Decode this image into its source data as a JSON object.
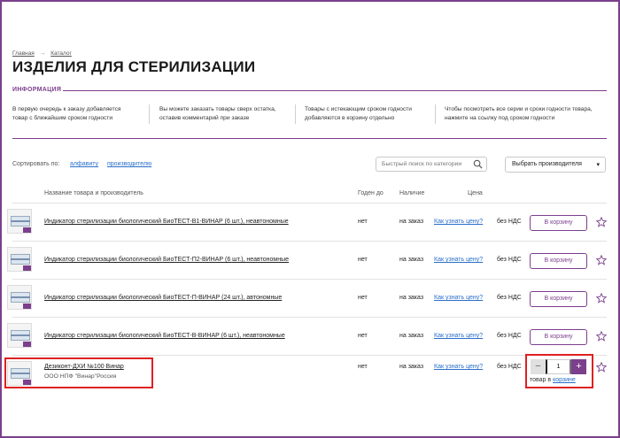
{
  "breadcrumb": {
    "home": "Главная",
    "separator": "→",
    "catalog": "Каталог"
  },
  "page_title": "ИЗДЕЛИЯ ДЛЯ СТЕРИЛИЗАЦИИ",
  "info": {
    "heading": "ИНФОРМАЦИЯ",
    "notes": [
      {
        "line1": "В первую очередь к заказу добавляется",
        "line2": "товар с ближайшим сроком годности"
      },
      {
        "line1": "Вы можете заказать товары сверх остатка,",
        "line2": "оставив комментарий при заказе"
      },
      {
        "line1": "Товары с истекающим сроком годности",
        "line2": "добавляются в корзину отдельно"
      },
      {
        "line1": "Чтобы посмотреть все серии и сроки годности товара,",
        "line2": "нажмите на ссылку под сроком годности"
      }
    ]
  },
  "sort": {
    "label": "Сортировать по:",
    "by_alpha": "алфавиту",
    "by_maker": "производителю"
  },
  "search": {
    "placeholder": "Быстрый поиск по категории"
  },
  "maker_select": {
    "value": "Выбрать производителя"
  },
  "table": {
    "headers": {
      "name": "Название товара и производитель",
      "expiry": "Годен до",
      "availability": "Наличие",
      "price": "Цена"
    },
    "rows": [
      {
        "name": "Индикатор стерилизации биологический БиоТЕСТ-В1-ВИНАР (6 шт.), неавтономные",
        "maker": "",
        "expiry": "нет",
        "availability": "на заказ",
        "price_link": "Как узнать цену?",
        "vat": "без НДС",
        "cart": "В корзину"
      },
      {
        "name": "Индикатор стерилизации биологический БиоТЕСТ-П2-ВИНАР (6 шт.), неавтономные",
        "maker": "",
        "expiry": "нет",
        "availability": "на заказ",
        "price_link": "Как узнать цену?",
        "vat": "без НДС",
        "cart": "В корзину"
      },
      {
        "name": "Индикатор стерилизации биологический БиоТЕСТ-П-ВИНАР (24 шт.), автономные",
        "maker": "",
        "expiry": "нет",
        "availability": "на заказ",
        "price_link": "Как узнать цену?",
        "vat": "без НДС",
        "cart": "В корзину"
      },
      {
        "name": "Индикатор стерилизации биологический БиоТЕСТ-В-ВИНАР (6 шт.), неавтономные",
        "maker": "",
        "expiry": "нет",
        "availability": "на заказ",
        "price_link": "Как узнать цену?",
        "vat": "без НДС",
        "cart": "В корзину"
      },
      {
        "name": "Дезиконт-ДХИ №100 Винар",
        "maker": "ООО НПФ \"Винар\"Россия",
        "expiry": "нет",
        "availability": "на заказ",
        "price_link": "Как узнать цену?",
        "vat": "без НДС",
        "quantity": "1",
        "in_cart_text": "товар в",
        "in_cart_link": "корзине"
      }
    ]
  },
  "colors": {
    "accent": "#7b3f8c",
    "link": "#2a6fc9",
    "highlight": "#e02020"
  }
}
